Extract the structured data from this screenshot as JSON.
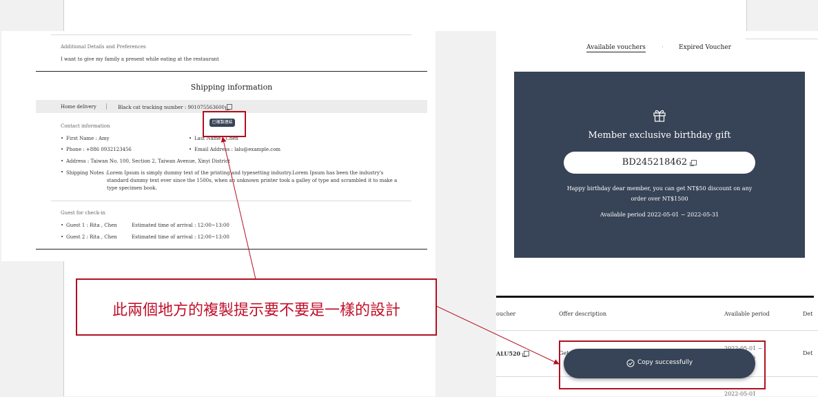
{
  "left": {
    "additional_label": "Additional Details and Preferences",
    "additional_text": "I want to give my family a present while eating at the restaurant",
    "shipping_title": "Shipping information",
    "delivery_method": "Home delivery",
    "tracking_label": "Black cat tracking number : 901075563600",
    "tooltip_text": "已複製連結",
    "contact_label": "Contact information",
    "first_name": "First Name : Amy",
    "last_name": "Last Name : Chen",
    "phone": "Phone : +886 0932123456",
    "email": "Email Address : lalu@example.com",
    "address": "Address : Taiwan No. 100, Section 2, Taiwan Avenue, Xinyi District",
    "notes_label": "Shipping Notes :",
    "notes_text": "Lorem Ipsum is simply dummy text of the printing and typesetting industry.Lorem Ipsum has been the industry's standard dummy text ever since the 1500s, when an unknown printer took a galley of type and scrambled it to make a type specimen book.",
    "guest_label": "Guest for check-in",
    "guests": [
      {
        "name": "Guest 1 : Rita , Chen",
        "arrival": "Estimated time of arrival : 12:00~13:00"
      },
      {
        "name": "Guest 2 : Rita , Chen",
        "arrival": "Estimated time of arrival : 12:00~13:00"
      }
    ]
  },
  "right": {
    "tab_available": "Available vouchers",
    "tab_separator": "·",
    "tab_expired": "Expired Voucher",
    "card_title": "Member exclusive birthday gift",
    "voucher_code": "BD245218462",
    "card_desc": "Happy birthday dear member, you can get NT$50 discount on any order over NT$1500",
    "card_period": "Available period  2022-05-01 ~ 2022-05-31",
    "table_headers": [
      "oucher",
      "Offer description",
      "Available period",
      "Det"
    ],
    "row_code": "ALU520",
    "row_offer_partial": "Get",
    "row_period_a": "2022-05-01 ~",
    "row_period_b": "0",
    "row_detail_partial": "Det",
    "row2_period_partial": "2022-05-01",
    "toast_text": "Copy successfully"
  },
  "annotation": {
    "text": "此兩個地方的複製提示要不要是一樣的設計"
  },
  "colors": {
    "card_bg": "#374356",
    "annotation_red": "#b01020",
    "toast_bg": "#374356"
  }
}
